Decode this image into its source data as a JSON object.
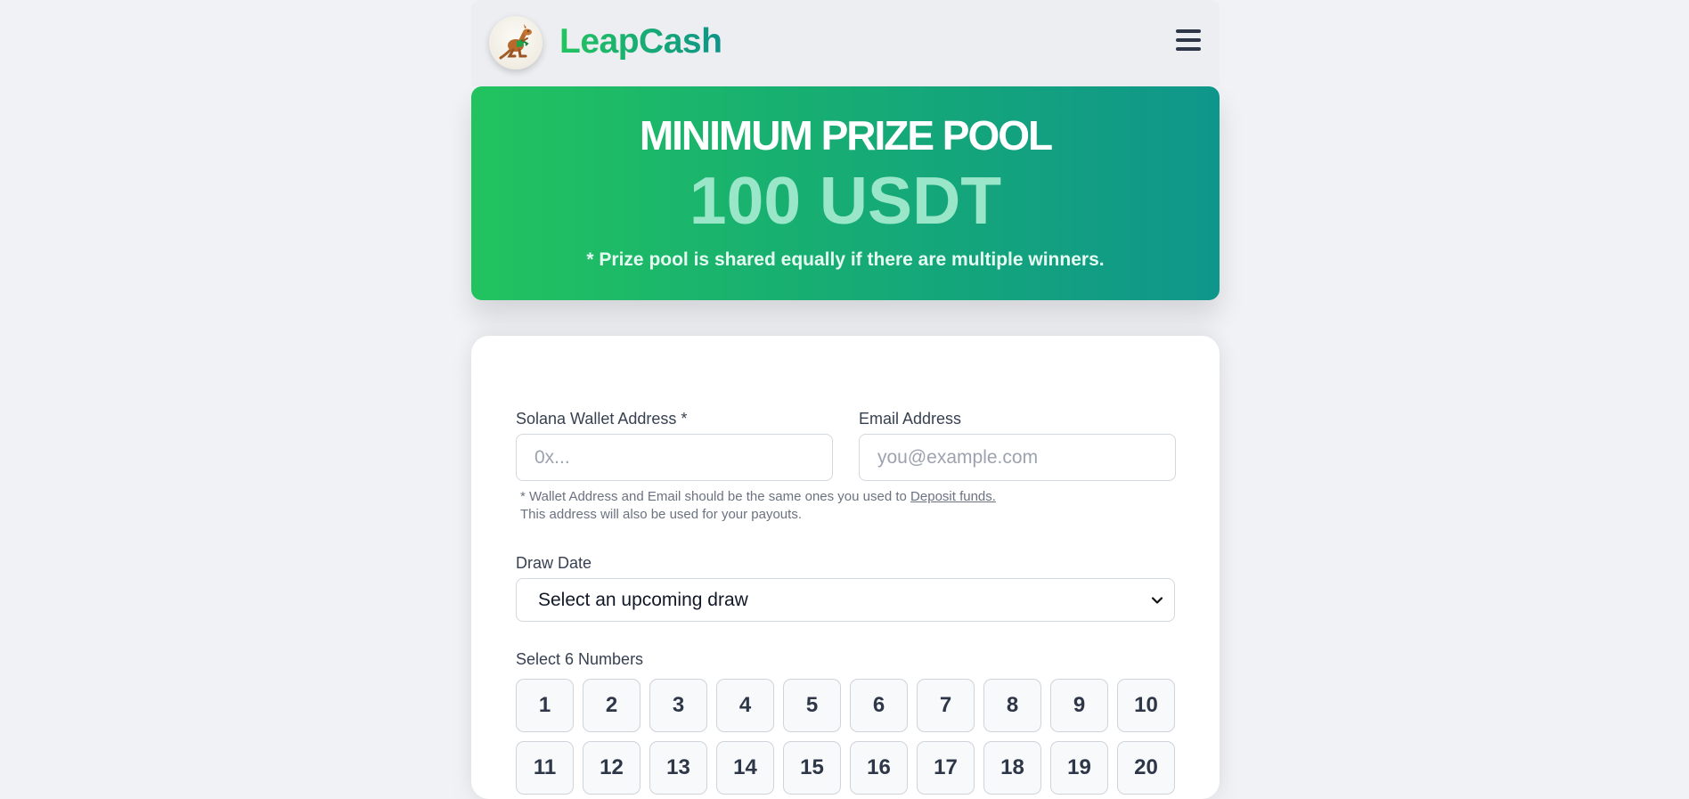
{
  "header": {
    "brand": "LeapCash",
    "logo_icon": "kangaroo-icon",
    "menu_icon": "hamburger-menu-icon"
  },
  "prize": {
    "title": "MINIMUM PRIZE POOL",
    "amount": "100 USDT",
    "note": "* Prize pool is shared equally if there are multiple winners."
  },
  "form": {
    "wallet": {
      "label": "Solana Wallet Address *",
      "placeholder": "0x...",
      "value": ""
    },
    "email": {
      "label": "Email Address",
      "placeholder": "you@example.com",
      "value": ""
    },
    "hint_line1": "* Wallet Address and Email should be the same ones you used to ",
    "hint_link": "Deposit funds.",
    "hint_line2": "This address will also be used for your payouts.",
    "draw_date": {
      "label": "Draw Date",
      "selected": "Select an upcoming draw"
    },
    "numbers_label": "Select 6 Numbers",
    "numbers": [
      "1",
      "2",
      "3",
      "4",
      "5",
      "6",
      "7",
      "8",
      "9",
      "10",
      "11",
      "12",
      "13",
      "14",
      "15",
      "16",
      "17",
      "18",
      "19",
      "20"
    ]
  },
  "colors": {
    "accent_green": "#22c55e",
    "accent_teal": "#0f9488",
    "background": "#f1f2f6"
  }
}
